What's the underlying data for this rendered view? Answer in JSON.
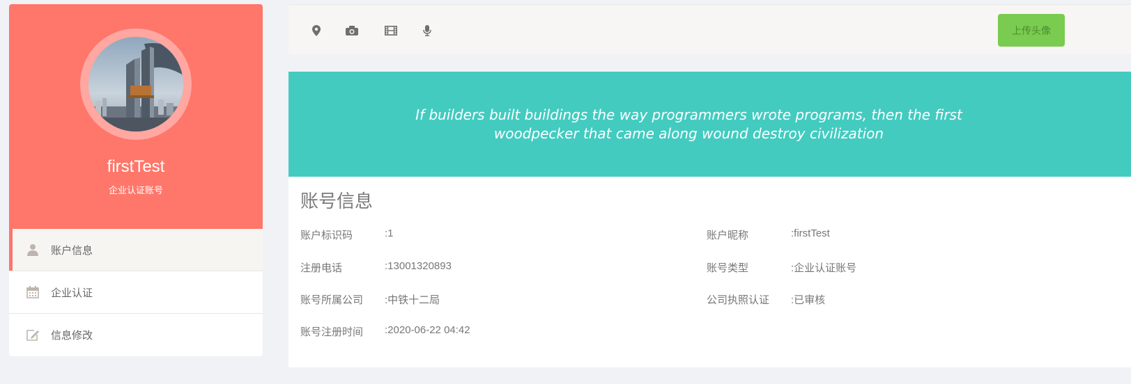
{
  "profile": {
    "username": "firstTest",
    "account_type": "企业认证账号",
    "avatar_alt": "building-photo"
  },
  "side_menu": {
    "items": [
      {
        "label": "账户信息",
        "icon": "user-icon",
        "active": true
      },
      {
        "label": "企业认证",
        "icon": "calendar-icon",
        "active": false
      },
      {
        "label": "信息修改",
        "icon": "edit-icon",
        "active": false
      }
    ]
  },
  "toolbar": {
    "icons": [
      "map-marker-icon",
      "camera-icon",
      "film-icon",
      "microphone-icon"
    ],
    "upload_label": "上传头像"
  },
  "quote": {
    "text": "If builders built buildings the way programmers wrote programs, then the first woodpecker that came along wound destroy civilization"
  },
  "account_info": {
    "title": "账号信息",
    "left": [
      {
        "label": "账户标识码",
        "value": ":1"
      },
      {
        "label": "注册电话",
        "value": ":13001320893"
      },
      {
        "label": "账号所属公司",
        "value": ":中铁十二局"
      },
      {
        "label": "账号注册时间",
        "value": ":2020-06-22 04:42"
      }
    ],
    "right": [
      {
        "label": "账户昵称",
        "value": ":firstTest"
      },
      {
        "label": "账号类型",
        "value": ":企业认证账号"
      },
      {
        "label": "公司执照认证",
        "value": ":已审核"
      }
    ]
  },
  "colors": {
    "profile_bg": "#ff766a",
    "banner_bg": "#43cbc0",
    "upload_btn": "#79cc4f"
  }
}
